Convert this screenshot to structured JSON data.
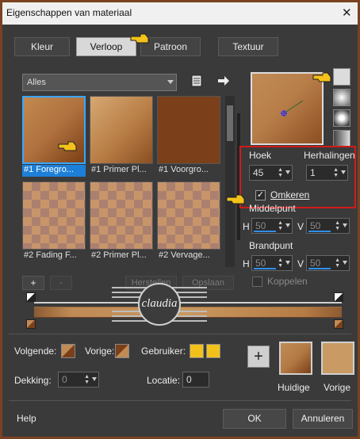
{
  "window": {
    "title": "Eigenschappen van materiaal",
    "close": "✕"
  },
  "tabs": [
    {
      "label": "Kleur",
      "active": false
    },
    {
      "label": "Verloop",
      "active": true
    },
    {
      "label": "Patroon",
      "active": false
    },
    {
      "label": "Textuur",
      "active": false
    }
  ],
  "library": {
    "category": "Alles",
    "items": [
      {
        "caption": "#1 Foregro...",
        "style": "g1",
        "selected": true
      },
      {
        "caption": "#1 Primer Pl...",
        "style": "g2",
        "selected": false
      },
      {
        "caption": "#1 Voorgro...",
        "style": "g3",
        "selected": false
      },
      {
        "caption": "#2 Fading F...",
        "style": "chk",
        "selected": false
      },
      {
        "caption": "#2 Primer Pl...",
        "style": "chk",
        "selected": false
      },
      {
        "caption": "#2 Vervage...",
        "style": "chk",
        "selected": false
      }
    ]
  },
  "gradient": {
    "hoek_label": "Hoek",
    "hoek_value": "45",
    "herhalingen_label": "Herhalingen",
    "herhalingen_value": "1",
    "omkeren_label": "Omkeren",
    "omkeren_checked": true,
    "middelpunt_label": "Middelpunt",
    "middel_h_label": "H",
    "middel_h": "50",
    "middel_v_label": "V",
    "middel_v": "50",
    "brandpunt_label": "Brandpunt",
    "brand_h_label": "H",
    "brand_h": "50",
    "brand_v_label": "V",
    "brand_v": "50",
    "koppelen_label": "Koppelen",
    "koppelen_checked": false
  },
  "editor": {
    "add": "+",
    "remove": "-",
    "herstellen": "Herstellen",
    "opslaan": "Opslaan"
  },
  "materials": {
    "volgende_label": "Volgende:",
    "vorige_label": "Vorige:",
    "gebruiker_label": "Gebruiker:",
    "dekking_label": "Dekking:",
    "dekking_value": "0",
    "locatie_label": "Locatie:",
    "locatie_value": "0",
    "huidige_label": "Huidige",
    "vorige2_label": "Vorige",
    "colors": {
      "fg": "#c08b56",
      "bg": "#7b4019",
      "user": "#f2c21b",
      "accent": "#1e7fd8",
      "frame": "#7a4220"
    }
  },
  "logo_text": "claudia",
  "footer": {
    "help": "Help",
    "ok": "OK",
    "annuleren": "Annuleren"
  }
}
